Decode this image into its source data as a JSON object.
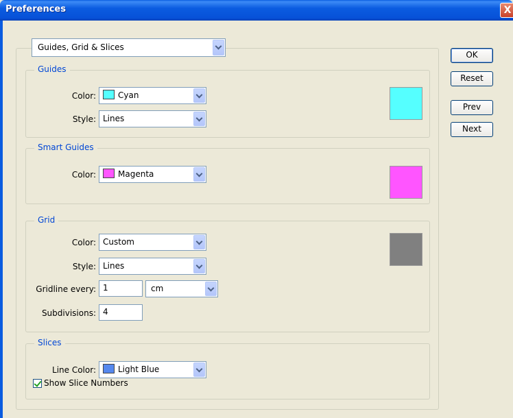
{
  "window": {
    "title": "Preferences",
    "close": "X"
  },
  "panel_select": "Guides, Grid & Slices",
  "buttons": {
    "ok": "OK",
    "reset": "Reset",
    "prev": "Prev",
    "next": "Next"
  },
  "guides": {
    "legend": "Guides",
    "color_label": "Color:",
    "color_value": "Cyan",
    "color_hex": "#55ffff",
    "style_label": "Style:",
    "style_value": "Lines"
  },
  "smart_guides": {
    "legend": "Smart Guides",
    "color_label": "Color:",
    "color_value": "Magenta",
    "color_hex": "#ff55ff"
  },
  "grid": {
    "legend": "Grid",
    "color_label": "Color:",
    "color_value": "Custom",
    "color_hex": "#808080",
    "style_label": "Style:",
    "style_value": "Lines",
    "gridline_label": "Gridline every:",
    "gridline_value": "1",
    "unit_value": "cm",
    "subdivisions_label": "Subdivisions:",
    "subdivisions_value": "4"
  },
  "slices": {
    "legend": "Slices",
    "line_color_label": "Line Color:",
    "line_color_value": "Light Blue",
    "line_color_hex": "#5588ee",
    "show_numbers_label": "Show Slice Numbers",
    "show_numbers_checked": true
  }
}
